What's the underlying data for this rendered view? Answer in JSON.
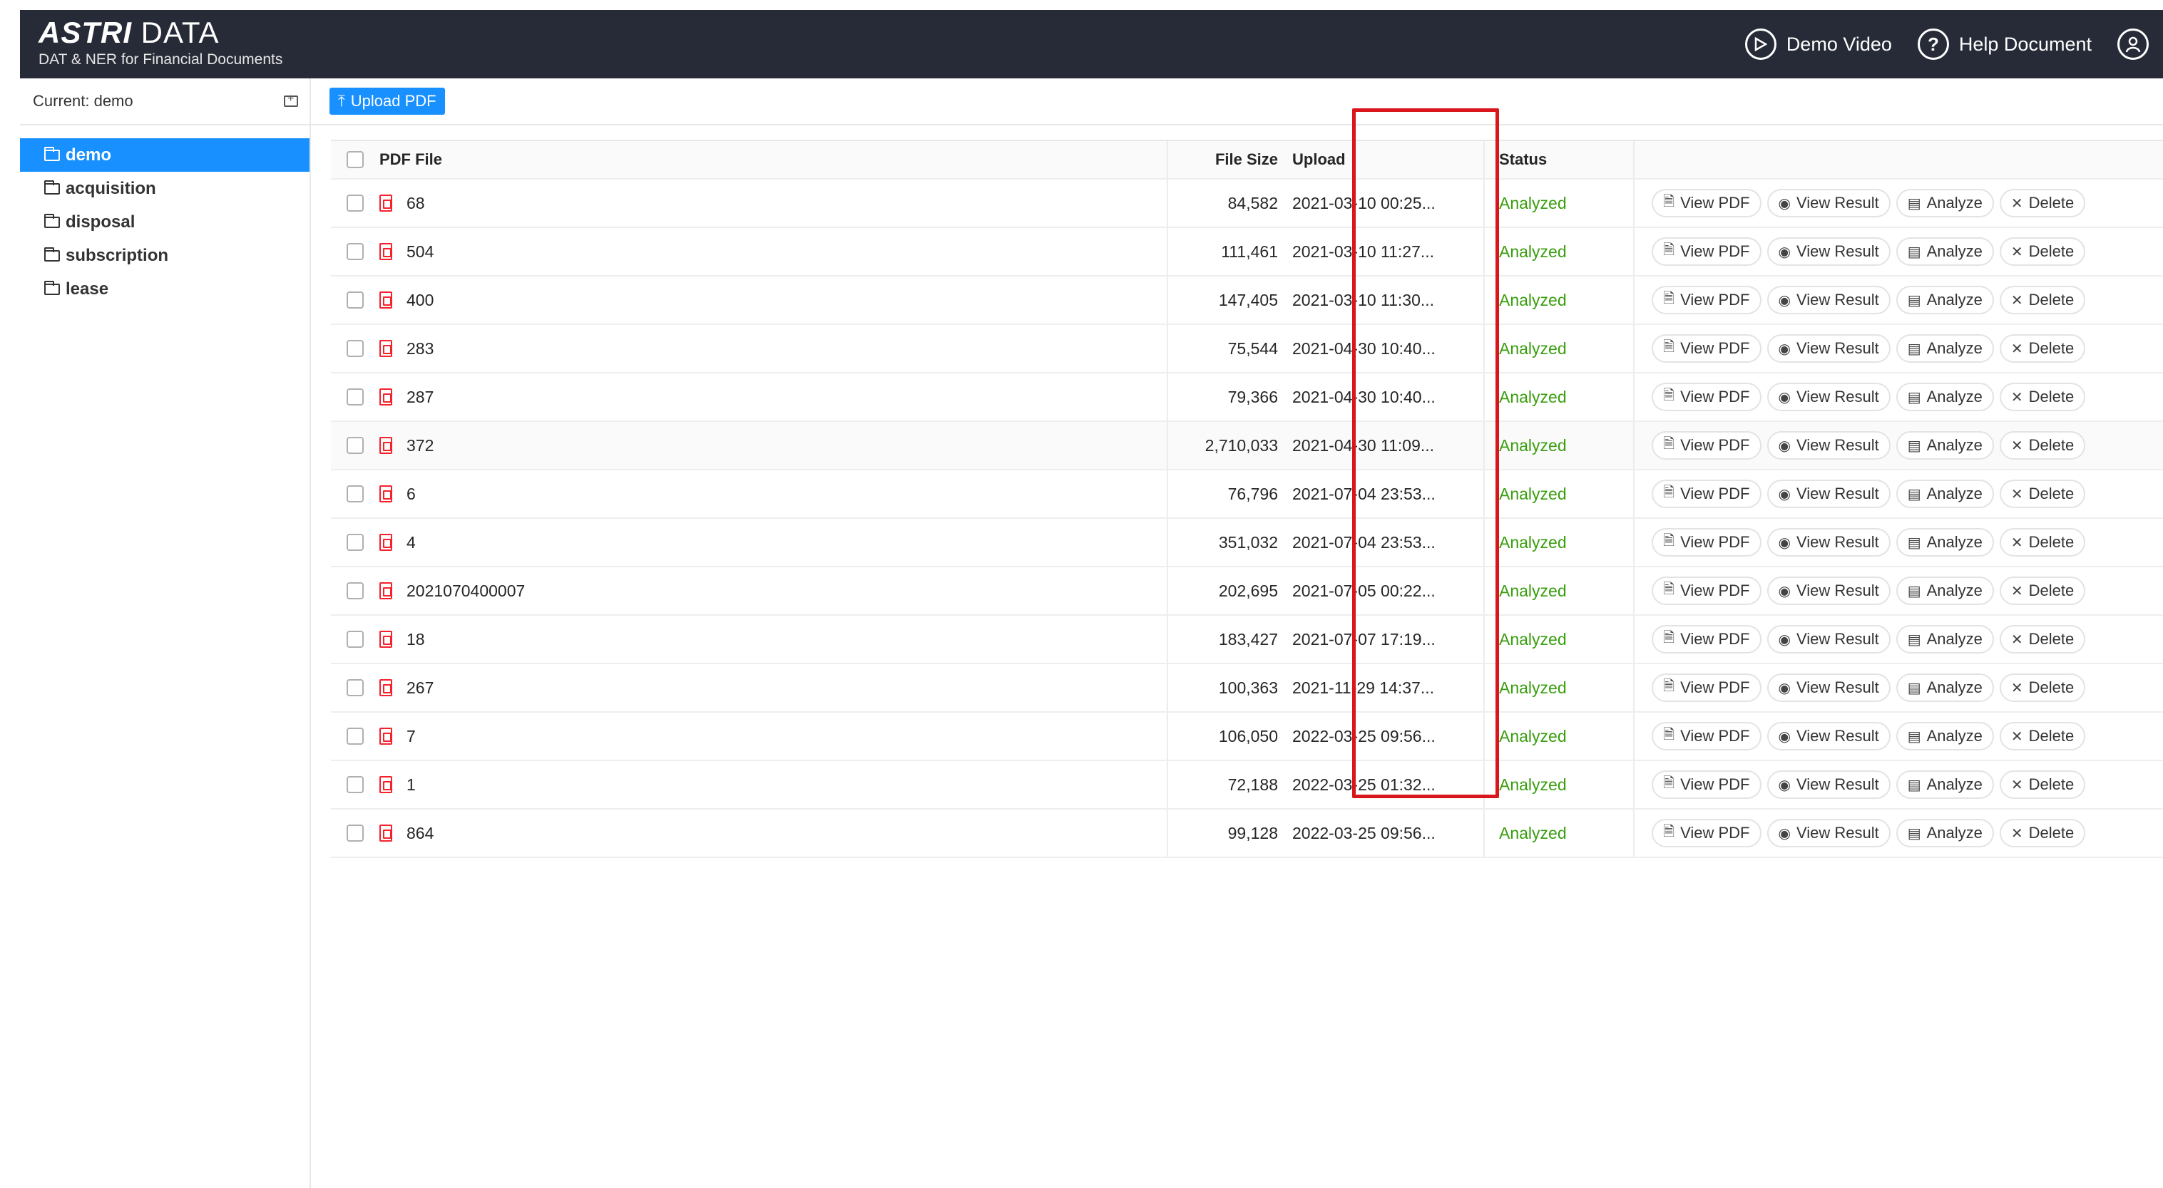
{
  "header": {
    "brand_bold": "ASTRI",
    "brand_light": "DATA",
    "subtitle": "DAT & NER for Financial Documents",
    "demo_video": "Demo Video",
    "help_document": "Help Document"
  },
  "sidebar": {
    "current": "Current: demo",
    "folders": [
      {
        "label": "demo",
        "active": true
      },
      {
        "label": "acquisition"
      },
      {
        "label": "disposal"
      },
      {
        "label": "subscription"
      },
      {
        "label": "lease"
      }
    ]
  },
  "toolbar": {
    "upload_label": "Upload PDF"
  },
  "table": {
    "columns": {
      "file": "PDF File",
      "size": "File Size",
      "upload": "Upload",
      "status": "Status"
    },
    "actions": {
      "view_pdf": "View PDF",
      "view_result": "View Result",
      "analyze": "Analyze",
      "delete": "Delete"
    },
    "rows": [
      {
        "name": "68",
        "size": "84,582",
        "upload": "2021-03-10 00:25...",
        "status": "Analyzed"
      },
      {
        "name": "504",
        "size": "111,461",
        "upload": "2021-03-10 11:27...",
        "status": "Analyzed"
      },
      {
        "name": "400",
        "size": "147,405",
        "upload": "2021-03-10 11:30...",
        "status": "Analyzed"
      },
      {
        "name": "283",
        "size": "75,544",
        "upload": "2021-04-30 10:40...",
        "status": "Analyzed"
      },
      {
        "name": "287",
        "size": "79,366",
        "upload": "2021-04-30 10:40...",
        "status": "Analyzed"
      },
      {
        "name": "372",
        "size": "2,710,033",
        "upload": "2021-04-30 11:09...",
        "status": "Analyzed"
      },
      {
        "name": "6",
        "size": "76,796",
        "upload": "2021-07-04 23:53...",
        "status": "Analyzed"
      },
      {
        "name": "4",
        "size": "351,032",
        "upload": "2021-07-04 23:53...",
        "status": "Analyzed"
      },
      {
        "name": "2021070400007",
        "size": "202,695",
        "upload": "2021-07-05 00:22...",
        "status": "Analyzed"
      },
      {
        "name": "18",
        "size": "183,427",
        "upload": "2021-07-07 17:19...",
        "status": "Analyzed"
      },
      {
        "name": "267",
        "size": "100,363",
        "upload": "2021-11-29 14:37...",
        "status": "Analyzed"
      },
      {
        "name": "7",
        "size": "106,050",
        "upload": "2022-03-25 09:56...",
        "status": "Analyzed"
      },
      {
        "name": "1",
        "size": "72,188",
        "upload": "2022-03-25 01:32...",
        "status": "Analyzed"
      },
      {
        "name": "864",
        "size": "99,128",
        "upload": "2022-03-25 09:56...",
        "status": "Analyzed"
      }
    ]
  },
  "colors": {
    "header_bg": "#272b37",
    "accent": "#1890ff",
    "status_green": "#389e0d",
    "highlight": "#d9161b"
  }
}
